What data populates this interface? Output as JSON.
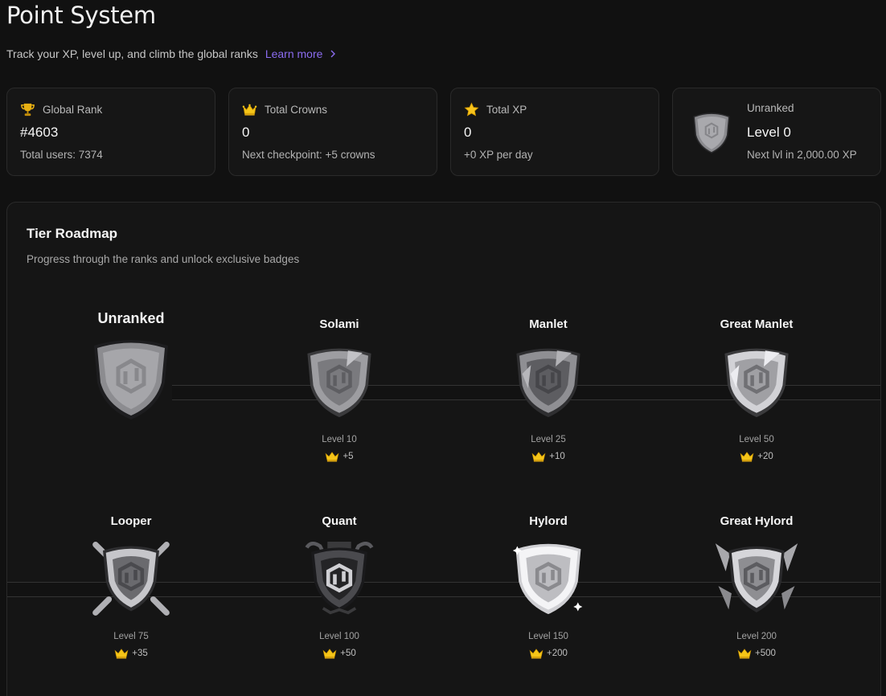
{
  "header": {
    "title": "Point System",
    "subtitle": "Track your XP, level up, and climb the global ranks",
    "learn_more": "Learn more"
  },
  "stats": [
    {
      "icon": "trophy-icon",
      "label": "Global Rank",
      "value": "#4603",
      "sub": "Total users: 7374"
    },
    {
      "icon": "crown-icon",
      "label": "Total Crowns",
      "value": "0",
      "sub": "Next checkpoint: +5 crowns"
    },
    {
      "icon": "star-icon",
      "label": "Total XP",
      "value": "0",
      "sub": "+0 XP per day"
    },
    {
      "icon": "shield-badge-icon",
      "label": "Unranked",
      "value": "Level 0",
      "sub": "Next lvl in 2,000.00 XP"
    }
  ],
  "roadmap": {
    "title": "Tier Roadmap",
    "subtitle": "Progress through the ranks and unlock exclusive badges",
    "tiers": [
      {
        "name": "Unranked",
        "level": "",
        "crowns": ""
      },
      {
        "name": "Solami",
        "level": "Level 10",
        "crowns": "+5"
      },
      {
        "name": "Manlet",
        "level": "Level 25",
        "crowns": "+10"
      },
      {
        "name": "Great Manlet",
        "level": "Level 50",
        "crowns": "+20"
      },
      {
        "name": "Looper",
        "level": "Level 75",
        "crowns": "+35"
      },
      {
        "name": "Quant",
        "level": "Level 100",
        "crowns": "+50"
      },
      {
        "name": "Hylord",
        "level": "Level 150",
        "crowns": "+200"
      },
      {
        "name": "Great Hylord",
        "level": "Level 200",
        "crowns": "+500"
      }
    ]
  },
  "colors": {
    "background": "#111111",
    "card": "#161616",
    "accent": "#8b6cf0",
    "crown": "#f5c518"
  }
}
